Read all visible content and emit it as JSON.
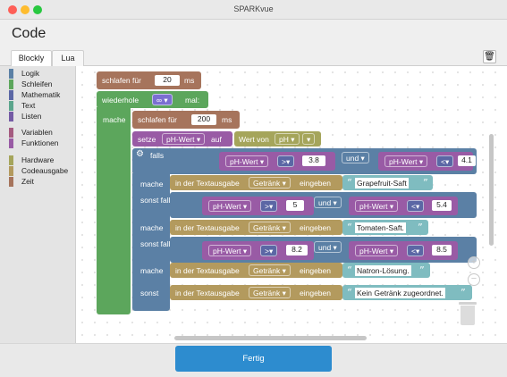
{
  "window": {
    "title": "SPARKvue"
  },
  "page": {
    "title": "Code"
  },
  "tabs": [
    {
      "label": "Blockly",
      "active": true
    },
    {
      "label": "Lua",
      "active": false
    }
  ],
  "toolbox": {
    "categories": [
      {
        "label": "Logik",
        "color": "#5b80a5"
      },
      {
        "label": "Schleifen",
        "color": "#5ca65c"
      },
      {
        "label": "Mathematik",
        "color": "#5b67a5"
      },
      {
        "label": "Text",
        "color": "#5ba58c"
      },
      {
        "label": "Listen",
        "color": "#745ba5"
      },
      {
        "label": "Variablen",
        "color": "#a55b80"
      },
      {
        "label": "Funktionen",
        "color": "#995ba5"
      },
      {
        "label": "Hardware",
        "color": "#a5a55b"
      },
      {
        "label": "Codeausgabe",
        "color": "#b39a5e"
      },
      {
        "label": "Zeit",
        "color": "#a6745c"
      }
    ]
  },
  "blocks": {
    "sleep1": {
      "label": "schlafen für",
      "value": "20",
      "unit": "ms"
    },
    "repeat": {
      "label": "wiederhole",
      "value": "∞ ▾",
      "suffix": "mal:",
      "do": "mache"
    },
    "sleep2": {
      "label": "schlafen für",
      "value": "200",
      "unit": "ms"
    },
    "set": {
      "label": "setze",
      "variable": "pH-Wert ▾",
      "to": "auf",
      "source_label": "Wert von",
      "source": "pH ▾",
      "source_extra": "▾"
    },
    "if": {
      "label": "falls",
      "elseif_label": "sonst falls",
      "do_label": "mache",
      "else_label": "sonst",
      "conditions": [
        {
          "var1": "pH-Wert ▾",
          "op1": ">▾",
          "val1": "3.8",
          "and": "und ▾",
          "var2": "pH-Wert ▾",
          "op2": "<▾",
          "val2": "4.1"
        },
        {
          "var1": "pH-Wert ▾",
          "op1": ">▾",
          "val1": "5",
          "and": "und ▾",
          "var2": "pH-Wert ▾",
          "op2": "<▾",
          "val2": "5.4"
        },
        {
          "var1": "pH-Wert ▾",
          "op1": ">▾",
          "val1": "8.2",
          "and": "und ▾",
          "var2": "pH-Wert ▾",
          "op2": "<▾",
          "val2": "8.5"
        }
      ],
      "outputs": [
        {
          "prefix": "in der Textausgabe",
          "target": "Getränk ▾",
          "action": "eingeben",
          "text": "Grapefruit-Saft"
        },
        {
          "prefix": "in der Textausgabe",
          "target": "Getränk ▾",
          "action": "eingeben",
          "text": "Tomaten-Saft."
        },
        {
          "prefix": "in der Textausgabe",
          "target": "Getränk ▾",
          "action": "eingeben",
          "text": "Natron-Lösung."
        },
        {
          "prefix": "in der Textausgabe",
          "target": "Getränk ▾",
          "action": "eingeben",
          "text": "Kein Getränk zugeordnet."
        }
      ]
    }
  },
  "icons": {
    "trash": "trash-icon",
    "gear": "gear-icon",
    "zoom_in": "zoom-in-icon",
    "zoom_out": "zoom-out-icon"
  },
  "glyphs": {
    "trash": "🗑",
    "gear": "⚙",
    "plus": "+",
    "minus": "−",
    "open_quote": "“",
    "close_quote": "”"
  },
  "footer": {
    "done_label": "Fertig"
  }
}
